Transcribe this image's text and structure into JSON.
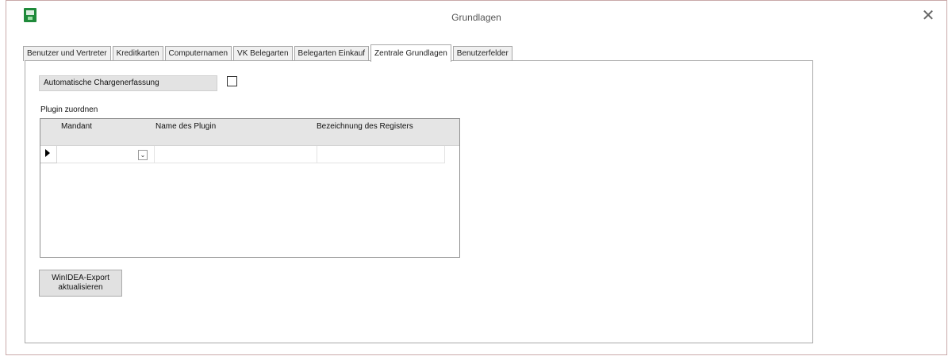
{
  "window": {
    "title": "Grundlagen",
    "close_glyph": "✕",
    "icon": "app-logo-icon"
  },
  "tabs": [
    {
      "label": "Benutzer und Vertreter",
      "active": false
    },
    {
      "label": "Kreditkarten",
      "active": false
    },
    {
      "label": "Computernamen",
      "active": false
    },
    {
      "label": "VK Belegarten",
      "active": false
    },
    {
      "label": "Belegarten Einkauf",
      "active": false
    },
    {
      "label": "Zentrale Grundlagen",
      "active": true
    },
    {
      "label": "Benutzerfelder",
      "active": false
    }
  ],
  "panel": {
    "auto_batch_label": "Automatische Chargenerfassung",
    "auto_batch_checked": false,
    "plugin_label": "Plugin zuordnen",
    "grid": {
      "columns": [
        "Mandant",
        "Name des Plugin",
        "Bezeichnung des Registers"
      ],
      "rows": [
        {
          "mandant": "",
          "name": "",
          "bezeichnung": ""
        }
      ],
      "combo_glyph": "⌄"
    },
    "export_button": "WinIDEA-Export\naktualisieren"
  }
}
